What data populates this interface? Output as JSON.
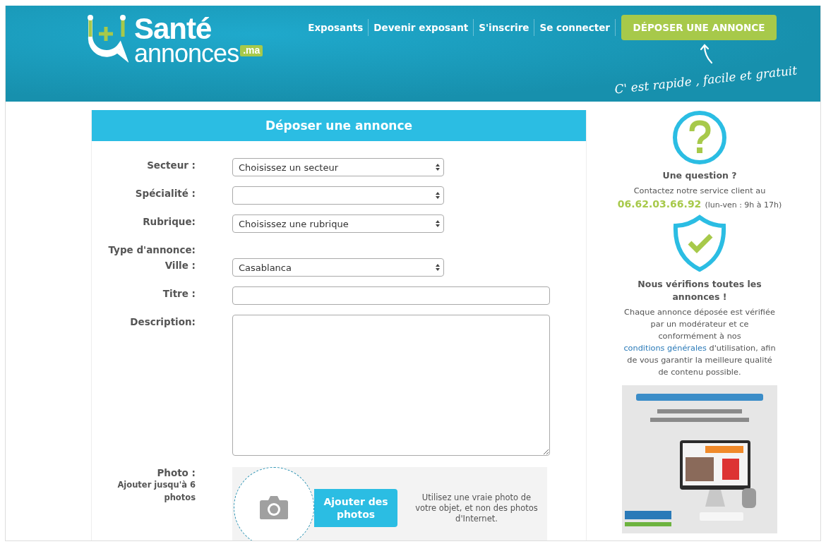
{
  "logo": {
    "title": "Santé",
    "subtitle": "annonces",
    "domain": ".ma"
  },
  "nav": [
    {
      "label": "Exposants"
    },
    {
      "label": "Devenir exposant"
    },
    {
      "label": "S'inscrire"
    },
    {
      "label": "Se connecter"
    }
  ],
  "cta_button": "DÉPOSER UNE ANNONCE",
  "tagline": "C' est rapide , facile et gratuit",
  "form": {
    "title": "Déposer une annonce",
    "fields": [
      {
        "label": "Secteur :",
        "kind": "select",
        "value": "Choisissez un secteur"
      },
      {
        "label": "Spécialité :",
        "kind": "select"
      },
      {
        "label": "Rubrique:",
        "kind": "select",
        "value": "Choisissez une rubrique"
      },
      {
        "label": "Type d'annonce:",
        "kind": "label"
      },
      {
        "label": "Ville :",
        "kind": "select",
        "value": "Casablanca"
      },
      {
        "label": "Titre :",
        "kind": "text"
      },
      {
        "label": "Description:",
        "kind": "textarea"
      }
    ],
    "photo": {
      "label": "Photo :",
      "hint": "Ajouter jusqu'à 6 photos",
      "button": "Ajouter des photos",
      "note": "Utilisez une vraie photo de votre objet, et non des photos d'Internet."
    }
  },
  "sidebar": {
    "question_title": "Une question ?",
    "contact_text": "Contactez notre service client au",
    "phone": "06.62.03.66.92",
    "hours": "(lun-ven : 9h à 17h)",
    "verify_title": "Nous vérifions toutes les annonces !",
    "verify_before": "Chaque annonce déposée est vérifiée par un modérateur et ce conformément à nos",
    "verify_link": "conditions générales",
    "verify_after": "d'utilisation, afin de vous garantir la meilleure qualité de contenu possible."
  }
}
